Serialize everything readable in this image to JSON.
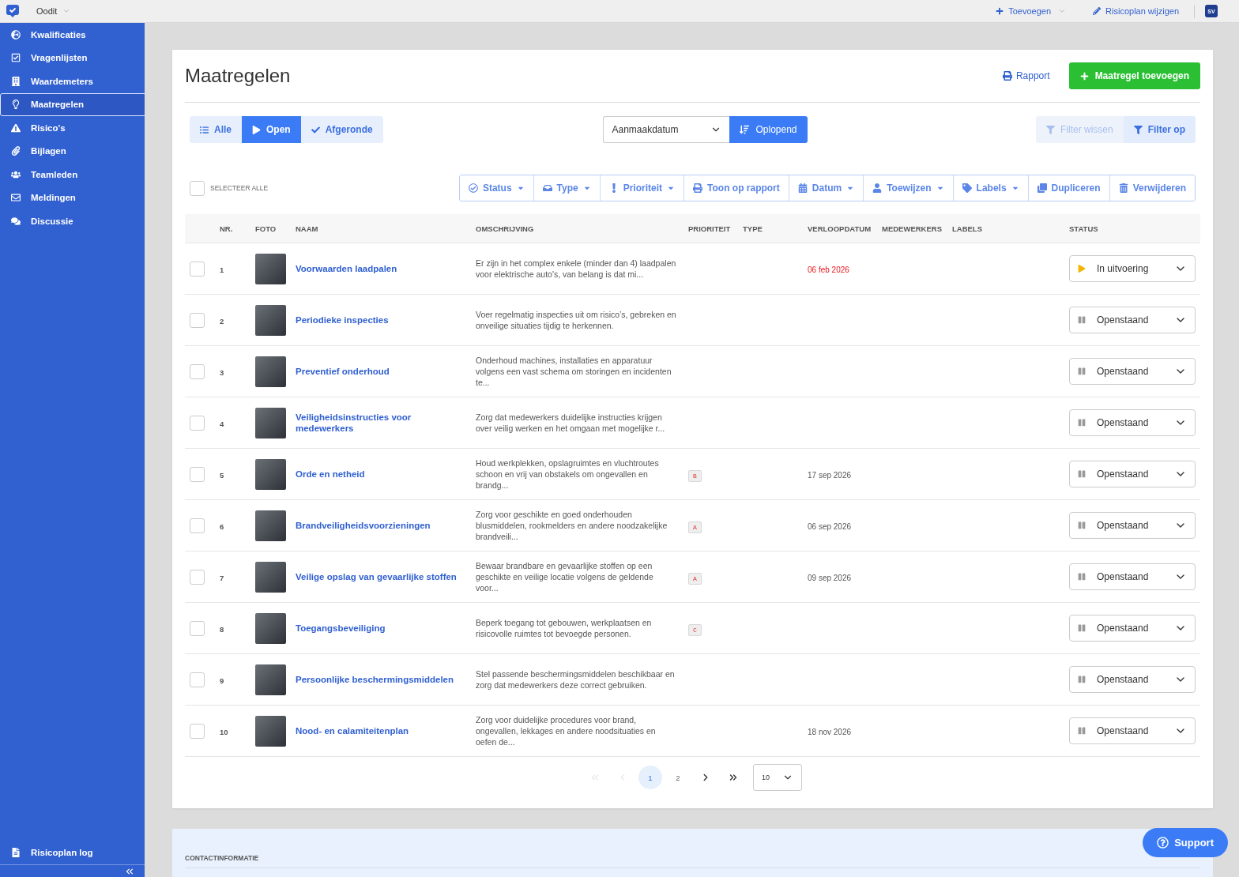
{
  "topbar": {
    "workspace": "Oodit",
    "add": "Toevoegen",
    "edit": "Risicoplan wijzigen",
    "user_initials": "SV"
  },
  "sidebar": {
    "items": [
      {
        "label": "Kwalificaties",
        "selected": false
      },
      {
        "label": "Vragenlijsten",
        "selected": false
      },
      {
        "label": "Waardemeters",
        "selected": false
      },
      {
        "label": "Maatregelen",
        "selected": true
      },
      {
        "label": "Risico's",
        "selected": false
      },
      {
        "label": "Bijlagen",
        "selected": false
      },
      {
        "label": "Teamleden",
        "selected": false
      },
      {
        "label": "Meldingen",
        "selected": false
      },
      {
        "label": "Discussie",
        "selected": false
      }
    ],
    "footer_item": "Risicoplan log"
  },
  "page": {
    "title": "Maatregelen",
    "report": "Rapport",
    "add_button": "Maatregel toevoegen"
  },
  "tabs": [
    {
      "label": "Alle",
      "selected": false
    },
    {
      "label": "Open",
      "selected": true
    },
    {
      "label": "Afgeronde",
      "selected": false
    }
  ],
  "sort": {
    "field": "Aanmaakdatum",
    "order": "Oplopend"
  },
  "filter": {
    "clear": "Filter wissen",
    "clear_disabled": true,
    "apply": "Filter op"
  },
  "select_all": {
    "label": "SELECTEER ALLE",
    "checked": false
  },
  "actions": [
    {
      "label": "Status",
      "dropdown": true
    },
    {
      "label": "Type",
      "dropdown": true
    },
    {
      "label": "Prioriteit",
      "dropdown": true
    },
    {
      "label": "Toon op rapport",
      "dropdown": false
    },
    {
      "label": "Datum",
      "dropdown": true
    },
    {
      "label": "Toewijzen",
      "dropdown": true
    },
    {
      "label": "Labels",
      "dropdown": true
    },
    {
      "label": "Dupliceren",
      "dropdown": false
    },
    {
      "label": "Verwijderen",
      "dropdown": false
    }
  ],
  "table": {
    "columns": [
      "NR.",
      "FOTO",
      "NAAM",
      "OMSCHRIJVING",
      "PRIORITEIT",
      "TYPE",
      "VERLOOPDATUM",
      "MEDEWERKERS",
      "LABELS",
      "STATUS"
    ],
    "rows": [
      {
        "nr": "1",
        "checked": false,
        "name": "Voorwaarden laadpalen",
        "description": "Er zijn in het complex enkele (minder dan 4) laadpalen voor elektrische auto's, van belang is dat mi...",
        "due": "06 feb 2026",
        "overdue": true,
        "status": {
          "kind": "active",
          "label": "In uitvoering"
        }
      },
      {
        "nr": "2",
        "checked": false,
        "name": "Periodieke inspecties",
        "description": "Voer regelmatig inspecties uit om risico’s, gebreken en onveilige situaties tijdig te herkennen.",
        "status": {
          "kind": "pending",
          "label": "Openstaand"
        }
      },
      {
        "nr": "3",
        "checked": false,
        "name": "Preventief onderhoud",
        "description": "Onderhoud machines, installaties en apparatuur volgens een vast schema om storingen en incidenten te...",
        "status": {
          "kind": "pending",
          "label": "Openstaand"
        }
      },
      {
        "nr": "4",
        "checked": false,
        "name": "Veiligheidsinstructies voor medewerkers",
        "description": "Zorg dat medewerkers duidelijke instructies krijgen over veilig werken en het omgaan met mogelijke r...",
        "status": {
          "kind": "pending",
          "label": "Openstaand"
        }
      },
      {
        "nr": "5",
        "checked": false,
        "name": "Orde en netheid",
        "description": "Houd werkplekken, opslagruimtes en vluchtroutes schoon en vrij van obstakels om ongevallen en brandg...",
        "priority": "B",
        "due": "17 sep 2026",
        "overdue": false,
        "status": {
          "kind": "pending",
          "label": "Openstaand"
        }
      },
      {
        "nr": "6",
        "checked": false,
        "name": "Brandveiligheidsvoorzieningen",
        "description": "Zorg voor geschikte en goed onderhouden blusmiddelen, rookmelders en andere noodzakelijke brandveili...",
        "priority": "A",
        "due": "06 sep 2026",
        "overdue": false,
        "status": {
          "kind": "pending",
          "label": "Openstaand"
        }
      },
      {
        "nr": "7",
        "checked": false,
        "name": "Veilige opslag van gevaarlijke stoffen",
        "description": "Bewaar brandbare en gevaarlijke stoffen op een geschikte en veilige locatie volgens de geldende voor...",
        "priority": "A",
        "due": "09 sep 2026",
        "overdue": false,
        "status": {
          "kind": "pending",
          "label": "Openstaand"
        }
      },
      {
        "nr": "8",
        "checked": false,
        "name": "Toegangsbeveiliging",
        "description": "Beperk toegang tot gebouwen, werkplaatsen en risicovolle ruimtes tot bevoegde personen.",
        "priority": "C",
        "status": {
          "kind": "pending",
          "label": "Openstaand"
        }
      },
      {
        "nr": "9",
        "checked": false,
        "name": "Persoonlijke beschermingsmiddelen",
        "description": "Stel passende beschermingsmiddelen beschikbaar en zorg dat medewerkers deze correct gebruiken.",
        "status": {
          "kind": "pending",
          "label": "Openstaand"
        }
      },
      {
        "nr": "10",
        "checked": false,
        "name": "Nood- en calamiteitenplan",
        "description": "Zorg voor duidelijke procedures voor brand, ongevallen, lekkages en andere noodsituaties en oefen de...",
        "due": "18 nov 2026",
        "overdue": false,
        "status": {
          "kind": "pending",
          "label": "Openstaand"
        }
      }
    ]
  },
  "pagination": {
    "items": [
      {
        "kind": "first",
        "disabled": true
      },
      {
        "kind": "prev",
        "disabled": true
      },
      {
        "kind": "page",
        "label": "1",
        "selected": true
      },
      {
        "kind": "page",
        "label": "2",
        "selected": false
      },
      {
        "kind": "next",
        "disabled": false
      },
      {
        "kind": "last",
        "disabled": false
      }
    ],
    "page_size": "10"
  },
  "contact": {
    "heading": "CONTACTINFORMATIE"
  },
  "support": "Support"
}
